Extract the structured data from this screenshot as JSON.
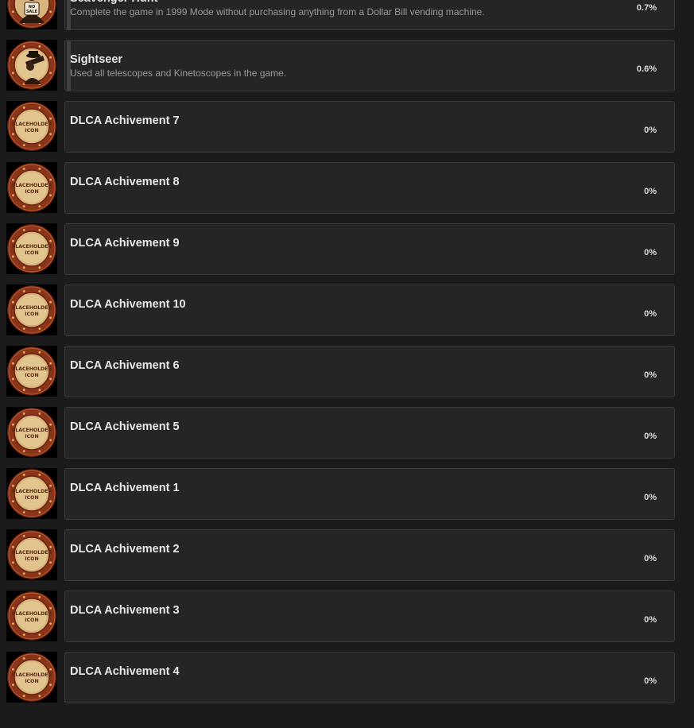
{
  "achievements": [
    {
      "title": "Scavenger Hunt",
      "description": "Complete the game in 1999 Mode without purchasing anything from a Dollar Bill vending machine.",
      "percent": "0.7%",
      "icon": "no-sale-icon",
      "icon_text": "NO SALE",
      "progress": 0.007
    },
    {
      "title": "Sightseer",
      "description": "Used all telescopes and Kinetoscopes in the game.",
      "percent": "0.6%",
      "icon": "telescope-icon",
      "progress": 0.006
    },
    {
      "title": "DLCA Achivement 7",
      "description": "",
      "percent": "0%",
      "icon": "placeholder-icon",
      "icon_text": "PLACEHOLDER ICON",
      "progress": 0
    },
    {
      "title": "DLCA Achivement 8",
      "description": "",
      "percent": "0%",
      "icon": "placeholder-icon",
      "icon_text": "PLACEHOLDER ICON",
      "progress": 0
    },
    {
      "title": "DLCA Achivement 9",
      "description": "",
      "percent": "0%",
      "icon": "placeholder-icon",
      "icon_text": "PLACEHOLDER ICON",
      "progress": 0
    },
    {
      "title": "DLCA Achivement 10",
      "description": "",
      "percent": "0%",
      "icon": "placeholder-icon",
      "icon_text": "PLACEHOLDER ICON",
      "progress": 0
    },
    {
      "title": "DLCA Achivement 6",
      "description": "",
      "percent": "0%",
      "icon": "placeholder-icon",
      "icon_text": "PLACEHOLDER ICON",
      "progress": 0
    },
    {
      "title": "DLCA Achivement 5",
      "description": "",
      "percent": "0%",
      "icon": "placeholder-icon",
      "icon_text": "PLACEHOLDER ICON",
      "progress": 0
    },
    {
      "title": "DLCA Achivement 1",
      "description": "",
      "percent": "0%",
      "icon": "placeholder-icon",
      "icon_text": "PLACEHOLDER ICON",
      "progress": 0
    },
    {
      "title": "DLCA Achivement 2",
      "description": "",
      "percent": "0%",
      "icon": "placeholder-icon",
      "icon_text": "PLACEHOLDER ICON",
      "progress": 0
    },
    {
      "title": "DLCA Achivement 3",
      "description": "",
      "percent": "0%",
      "icon": "placeholder-icon",
      "icon_text": "PLACEHOLDER ICON",
      "progress": 0
    },
    {
      "title": "DLCA Achivement 4",
      "description": "",
      "percent": "0%",
      "icon": "placeholder-icon",
      "icon_text": "PLACEHOLDER ICON",
      "progress": 0
    }
  ],
  "colors": {
    "background": "#1b1b1c",
    "card": "#252526",
    "card_border": "#3a3a3b",
    "progress_bar": "#404143",
    "title": "#e8e8e8",
    "description": "#9a9a9a",
    "badge_rim": "#7a2a16",
    "badge_face": "#d9b57e"
  }
}
